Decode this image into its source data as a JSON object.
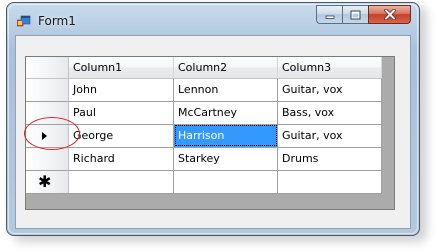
{
  "window": {
    "title": "Form1",
    "icons": {
      "app": "form-app-icon",
      "minimize": "minimize-icon",
      "maximize": "maximize-icon",
      "close": "close-icon"
    },
    "colors": {
      "selection": "#3399ff",
      "annotation_ellipse": "#d8232a",
      "close_button": "#c2402a"
    }
  },
  "grid": {
    "columns": [
      "Column1",
      "Column2",
      "Column3"
    ],
    "rows": [
      {
        "cells": [
          "John",
          "Lennon",
          "Guitar, vox"
        ],
        "row_header": ""
      },
      {
        "cells": [
          "Paul",
          "McCartney",
          "Bass, vox"
        ],
        "row_header": ""
      },
      {
        "cells": [
          "George",
          "Harrison",
          "Guitar, vox"
        ],
        "row_header": "current-row-arrow-icon"
      },
      {
        "cells": [
          "Richard",
          "Starkey",
          "Drums"
        ],
        "row_header": ""
      }
    ],
    "new_row_marker": "✱",
    "selected_cell": {
      "row": 2,
      "column": 1
    }
  }
}
